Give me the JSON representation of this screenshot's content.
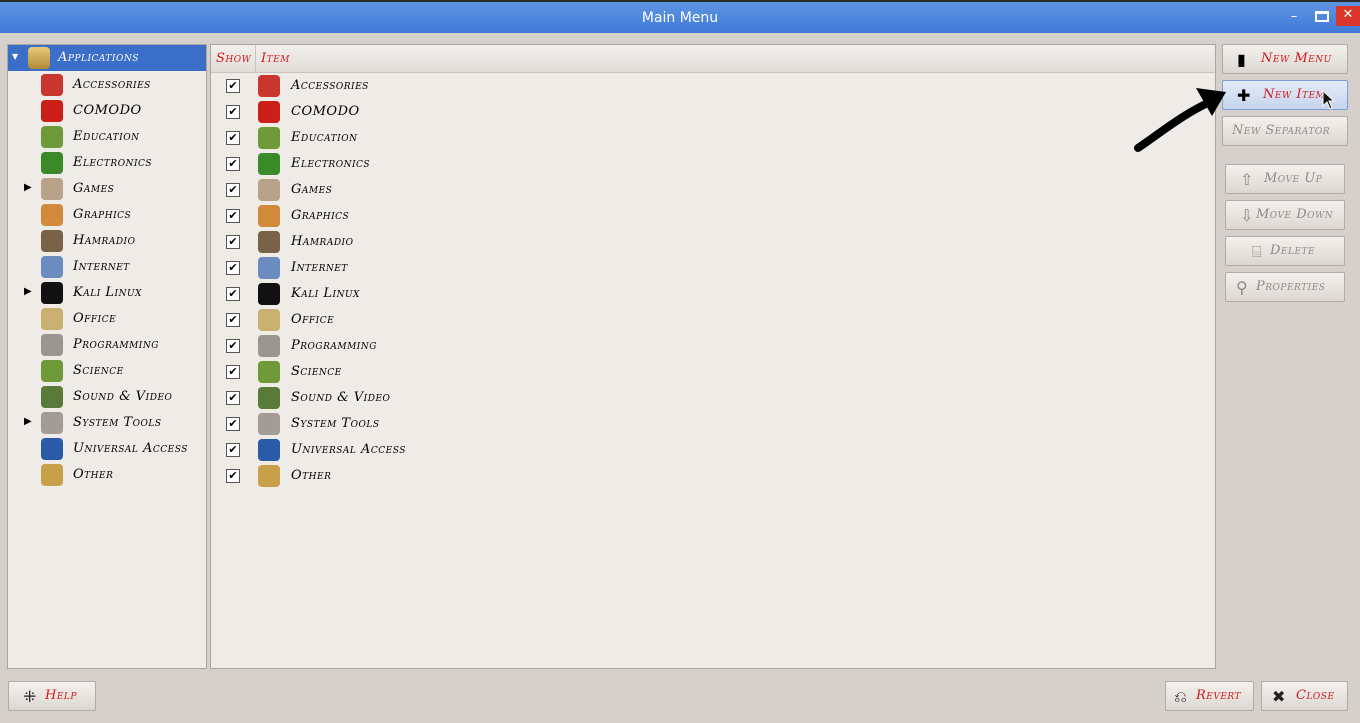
{
  "window": {
    "title": "Main Menu",
    "minimize": "–",
    "close": "✕"
  },
  "tree": {
    "root": {
      "label": "Applications",
      "icon": "applications-icon"
    },
    "items": [
      {
        "label": "Accessories",
        "icon": "accessories-icon",
        "color": "#c8362d",
        "expandable": false
      },
      {
        "label": "COMODO",
        "icon": "comodo-icon",
        "color": "#cc1f1a",
        "expandable": false
      },
      {
        "label": "Education",
        "icon": "education-icon",
        "color": "#6f9a3a",
        "expandable": false
      },
      {
        "label": "Electronics",
        "icon": "electronics-icon",
        "color": "#3a8a2a",
        "expandable": false
      },
      {
        "label": "Games",
        "icon": "games-icon",
        "color": "#b8a28a",
        "expandable": true
      },
      {
        "label": "Graphics",
        "icon": "graphics-icon",
        "color": "#d08a3a",
        "expandable": false
      },
      {
        "label": "Hamradio",
        "icon": "hamradio-icon",
        "color": "#7a6248",
        "expandable": false
      },
      {
        "label": "Internet",
        "icon": "internet-icon",
        "color": "#6a8cc0",
        "expandable": false
      },
      {
        "label": "Kali Linux",
        "icon": "kali-linux-icon",
        "color": "#111111",
        "expandable": true
      },
      {
        "label": "Office",
        "icon": "office-icon",
        "color": "#c9b070",
        "expandable": false
      },
      {
        "label": "Programming",
        "icon": "programming-icon",
        "color": "#9a9690",
        "expandable": false
      },
      {
        "label": "Science",
        "icon": "science-icon",
        "color": "#6f9a3a",
        "expandable": false
      },
      {
        "label": "Sound & Video",
        "icon": "sound-video-icon",
        "color": "#5a7a3a",
        "expandable": false
      },
      {
        "label": "System Tools",
        "icon": "system-tools-icon",
        "color": "#a39c94",
        "expandable": true
      },
      {
        "label": "Universal Access",
        "icon": "universal-access-icon",
        "color": "#2a5aa8",
        "expandable": false
      },
      {
        "label": "Other",
        "icon": "other-icon",
        "color": "#c9a04a",
        "expandable": false
      }
    ]
  },
  "table": {
    "headers": {
      "show": "Show",
      "item": "Item"
    },
    "rows": [
      {
        "show": true,
        "label": "Accessories"
      },
      {
        "show": true,
        "label": "COMODO"
      },
      {
        "show": true,
        "label": "Education"
      },
      {
        "show": true,
        "label": "Electronics"
      },
      {
        "show": true,
        "label": "Games"
      },
      {
        "show": true,
        "label": "Graphics"
      },
      {
        "show": true,
        "label": "Hamradio"
      },
      {
        "show": true,
        "label": "Internet"
      },
      {
        "show": true,
        "label": "Kali Linux"
      },
      {
        "show": true,
        "label": "Office"
      },
      {
        "show": true,
        "label": "Programming"
      },
      {
        "show": true,
        "label": "Science"
      },
      {
        "show": true,
        "label": "Sound & Video"
      },
      {
        "show": true,
        "label": "System Tools"
      },
      {
        "show": true,
        "label": "Universal Access"
      },
      {
        "show": true,
        "label": "Other"
      }
    ],
    "check_glyph": "✔"
  },
  "buttons": {
    "new_menu": "New Menu",
    "new_item": "New Item",
    "new_separator": "New Separator",
    "move_up": "Move Up",
    "move_down": "Move Down",
    "delete": "Delete",
    "properties": "Properties",
    "help": "Help",
    "revert": "Revert",
    "close": "Close"
  },
  "colors": {
    "accent_red": "#d11a1a",
    "selection_blue": "#3b6ec8",
    "titlebar_blue": "#4a84dc"
  }
}
